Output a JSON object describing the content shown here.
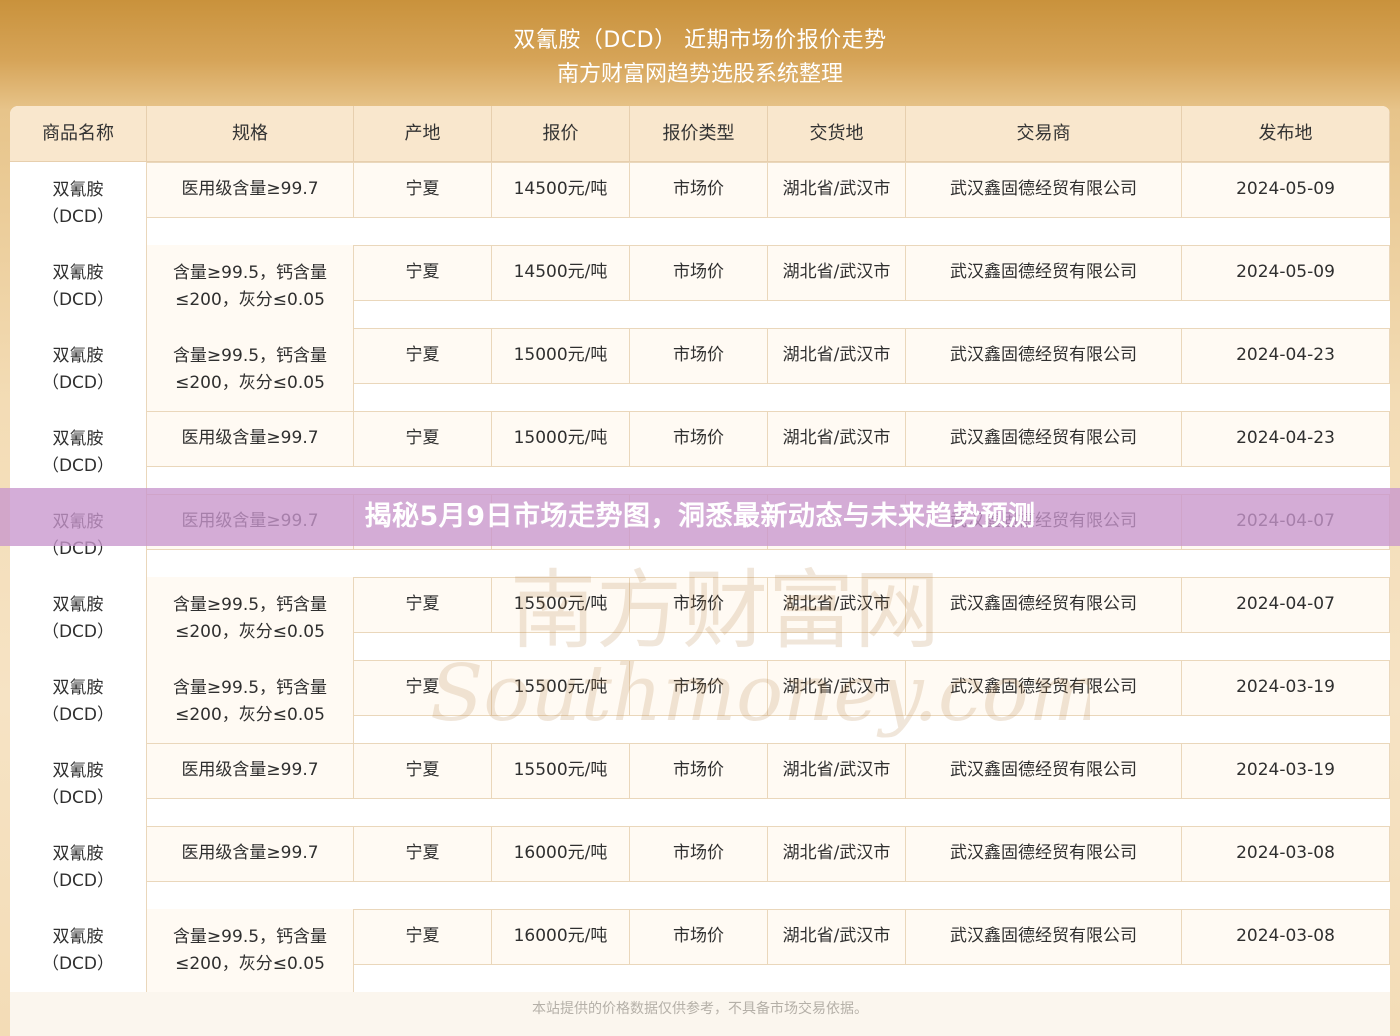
{
  "header": {
    "title": "双氰胺（DCD） 近期市场价报价走势",
    "subtitle": "南方财富网趋势选股系统整理"
  },
  "table": {
    "columns": [
      "商品名称",
      "规格",
      "产地",
      "报价",
      "报价类型",
      "交货地",
      "交易商",
      "发布地"
    ],
    "rows": [
      {
        "name": "双氰胺\n（DCD）",
        "spec": "医用级含量≥99.7",
        "origin": "宁夏",
        "price": "14500元/吨",
        "price_type": "市场价",
        "delivery": "湖北省/武汉市",
        "trader": "武汉鑫固德经贸有限公司",
        "date": "2024-05-09"
      },
      {
        "name": "双氰胺\n（DCD）",
        "spec": "含量≥99.5，钙含量\n≤200，灰分≤0.05",
        "origin": "宁夏",
        "price": "14500元/吨",
        "price_type": "市场价",
        "delivery": "湖北省/武汉市",
        "trader": "武汉鑫固德经贸有限公司",
        "date": "2024-05-09"
      },
      {
        "name": "双氰胺\n（DCD）",
        "spec": "含量≥99.5，钙含量\n≤200，灰分≤0.05",
        "origin": "宁夏",
        "price": "15000元/吨",
        "price_type": "市场价",
        "delivery": "湖北省/武汉市",
        "trader": "武汉鑫固德经贸有限公司",
        "date": "2024-04-23"
      },
      {
        "name": "双氰胺\n（DCD）",
        "spec": "医用级含量≥99.7",
        "origin": "宁夏",
        "price": "15000元/吨",
        "price_type": "市场价",
        "delivery": "湖北省/武汉市",
        "trader": "武汉鑫固德经贸有限公司",
        "date": "2024-04-23"
      },
      {
        "name": "双氰胺\n（DCD）",
        "spec": "医用级含量≥99.7",
        "origin": "",
        "price": "",
        "price_type": "",
        "delivery": "",
        "trader": "武汉鑫固德经贸有限公司",
        "date": "2024-04-07"
      },
      {
        "name": "双氰胺\n（DCD）",
        "spec": "含量≥99.5，钙含量\n≤200，灰分≤0.05",
        "origin": "宁夏",
        "price": "15500元/吨",
        "price_type": "市场价",
        "delivery": "湖北省/武汉市",
        "trader": "武汉鑫固德经贸有限公司",
        "date": "2024-04-07"
      },
      {
        "name": "双氰胺\n（DCD）",
        "spec": "含量≥99.5，钙含量\n≤200，灰分≤0.05",
        "origin": "宁夏",
        "price": "15500元/吨",
        "price_type": "市场价",
        "delivery": "湖北省/武汉市",
        "trader": "武汉鑫固德经贸有限公司",
        "date": "2024-03-19"
      },
      {
        "name": "双氰胺\n（DCD）",
        "spec": "医用级含量≥99.7",
        "origin": "宁夏",
        "price": "15500元/吨",
        "price_type": "市场价",
        "delivery": "湖北省/武汉市",
        "trader": "武汉鑫固德经贸有限公司",
        "date": "2024-03-19"
      },
      {
        "name": "双氰胺\n（DCD）",
        "spec": "医用级含量≥99.7",
        "origin": "宁夏",
        "price": "16000元/吨",
        "price_type": "市场价",
        "delivery": "湖北省/武汉市",
        "trader": "武汉鑫固德经贸有限公司",
        "date": "2024-03-08"
      },
      {
        "name": "双氰胺\n（DCD）",
        "spec": "含量≥99.5，钙含量\n≤200，灰分≤0.05",
        "origin": "宁夏",
        "price": "16000元/吨",
        "price_type": "市场价",
        "delivery": "湖北省/武汉市",
        "trader": "武汉鑫固德经贸有限公司",
        "date": "2024-03-08"
      }
    ]
  },
  "overlay_title": "揭秘5月9日市场走势图，洞悉最新动态与未来趋势预测",
  "watermark": {
    "cn": "南方财富网",
    "en": "Southmoney.com"
  },
  "footer": "本站提供的价格数据仅供参考，不具备市场交易依据。"
}
